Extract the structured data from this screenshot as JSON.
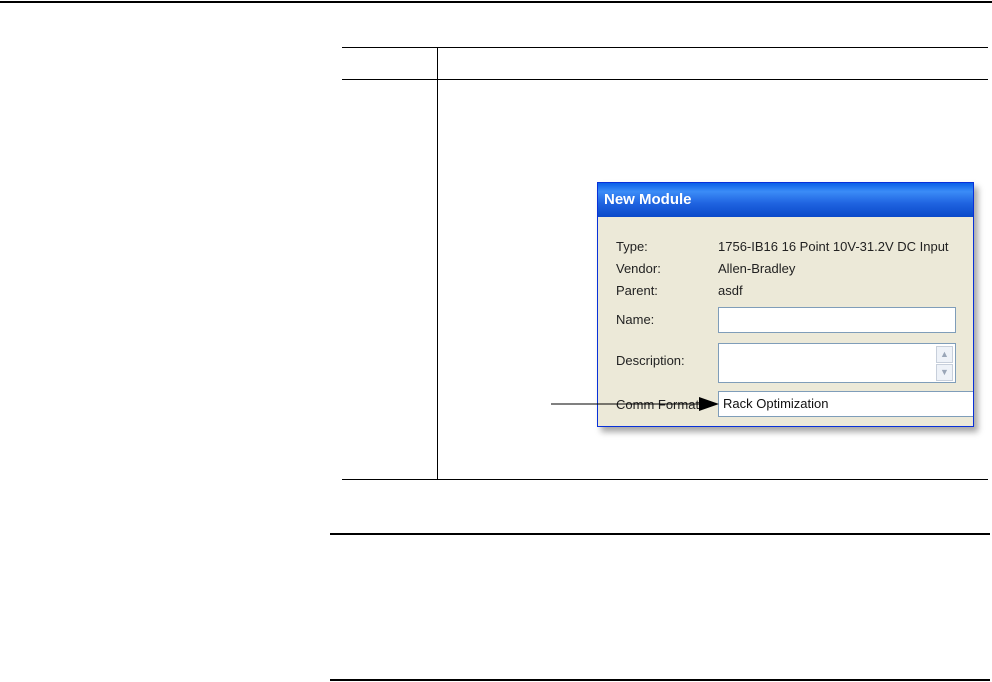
{
  "dialog": {
    "title": "New Module",
    "type_label": "Type:",
    "type_value": "1756-IB16 16 Point 10V-31.2V DC Input",
    "vendor_label": "Vendor:",
    "vendor_value": "Allen-Bradley",
    "parent_label": "Parent:",
    "parent_value": "asdf",
    "name_label": "Name:",
    "name_value": "",
    "description_label": "Description:",
    "description_value": "",
    "comm_format_label": "Comm Format:",
    "comm_format_value": "Rack Optimization"
  }
}
